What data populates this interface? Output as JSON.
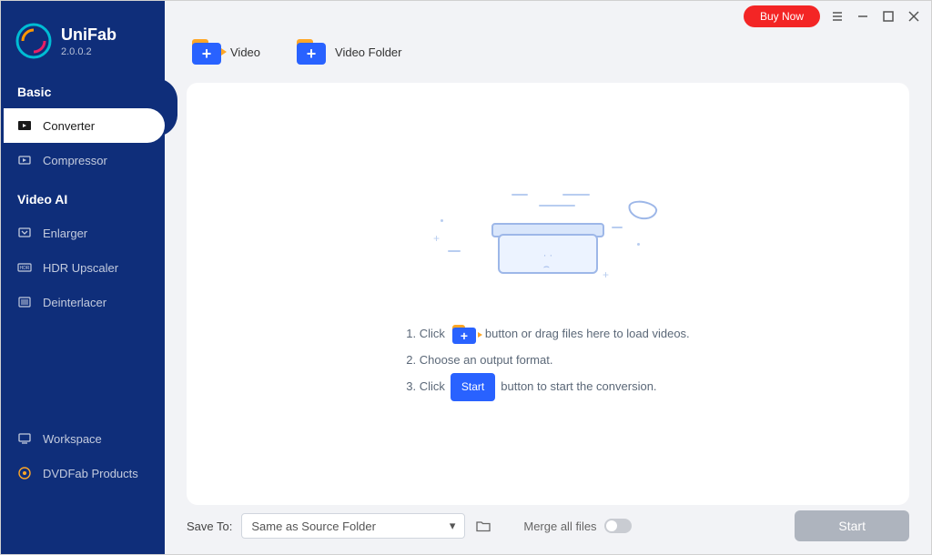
{
  "app": {
    "name": "UniFab",
    "version": "2.0.0.2"
  },
  "titlebar": {
    "buy_label": "Buy Now"
  },
  "sidebar": {
    "section_basic": "Basic",
    "section_videoai": "Video AI",
    "items": {
      "converter": "Converter",
      "compressor": "Compressor",
      "enlarger": "Enlarger",
      "hdr_upscaler": "HDR Upscaler",
      "deinterlacer": "Deinterlacer",
      "workspace": "Workspace",
      "dvdfab": "DVDFab Products"
    }
  },
  "toolbar": {
    "video_label": "Video",
    "video_folder_label": "Video Folder"
  },
  "instructions": {
    "line1_a": "1. Click",
    "line1_b": "button or drag files here to load videos.",
    "line2": "2. Choose an output format.",
    "line3_a": "3. Click",
    "line3_btn": "Start",
    "line3_b": "button to start the conversion."
  },
  "footer": {
    "save_to_label": "Save To:",
    "save_to_value": "Same as Source Folder",
    "merge_label": "Merge all files",
    "start_label": "Start"
  }
}
